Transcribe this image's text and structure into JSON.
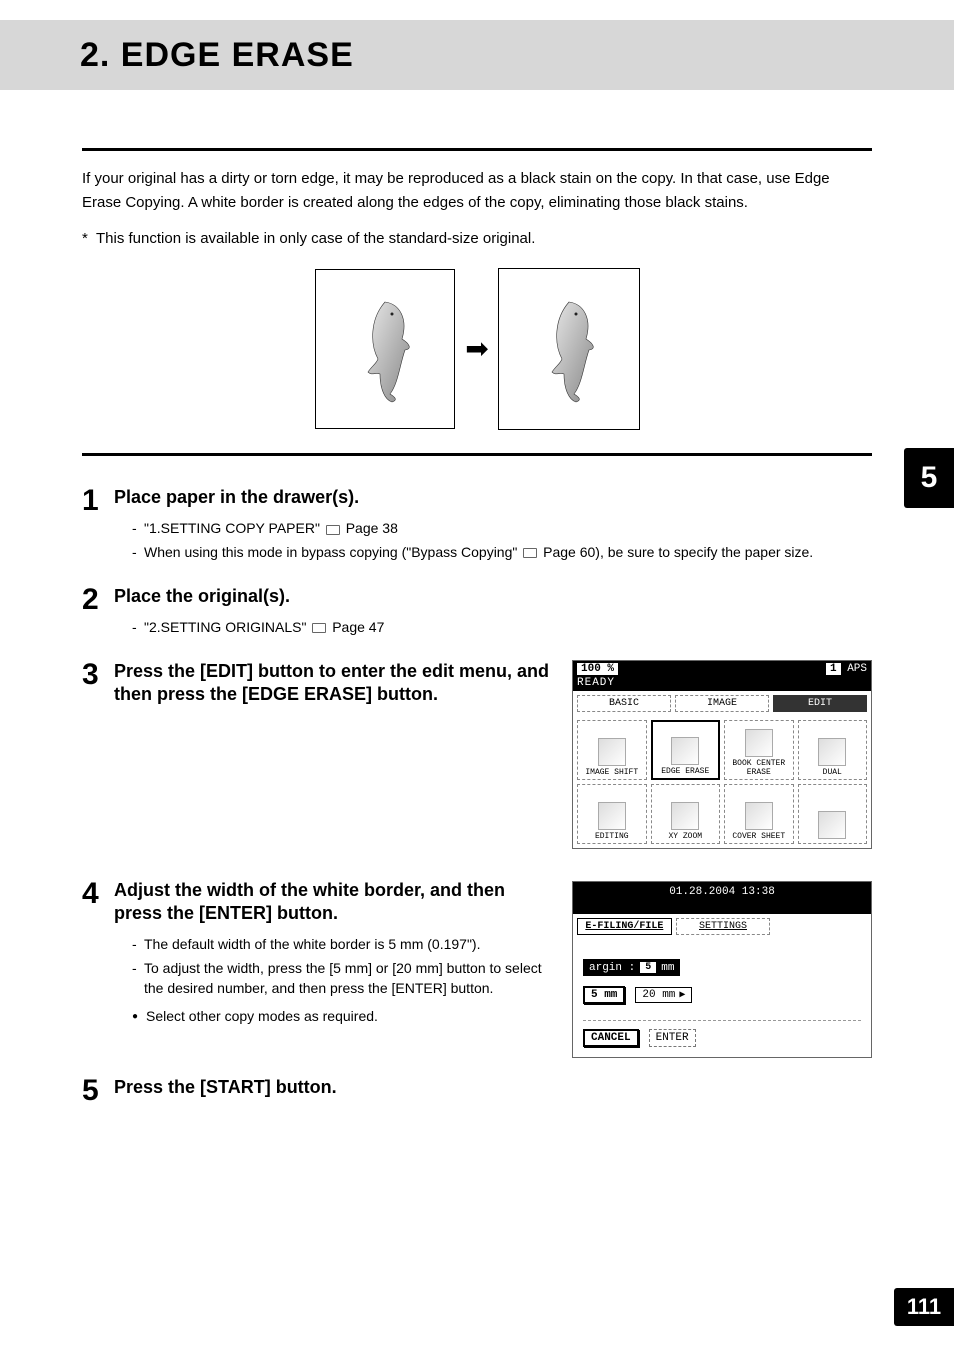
{
  "title": "2. EDGE ERASE",
  "chapter_tab": "5",
  "page_number": "111",
  "intro_para": "If your original has a dirty or torn edge, it may be reproduced as a black stain on the copy. In that case, use Edge Erase Copying. A white border is created along the edges of the copy, eliminating those black stains.",
  "note_line": "This function is available in only case of the standard-size original.",
  "steps": {
    "s1": {
      "num": "1",
      "title": "Place paper in the drawer(s).",
      "sub1_pre": "\"1.SETTING COPY PAPER\" ",
      "sub1_post": " Page 38",
      "sub2_pre": "When using this mode in bypass copying (\"Bypass Copying\" ",
      "sub2_post": " Page 60), be sure to specify the paper size."
    },
    "s2": {
      "num": "2",
      "title": "Place the original(s).",
      "sub1_pre": "\"2.SETTING ORIGINALS\" ",
      "sub1_post": " Page 47"
    },
    "s3": {
      "num": "3",
      "title": "Press the [EDIT] button to enter the edit menu, and then press the [EDGE ERASE] button."
    },
    "s4": {
      "num": "4",
      "title": "Adjust the width of the white border, and then press the [ENTER] button.",
      "sub1": "The default width of the white border is 5 mm (0.197\").",
      "sub2": "To adjust the width, press the [5 mm] or [20 mm] button to select the desired number, and then press the [ENTER] button.",
      "bullet": "Select other copy modes as required."
    },
    "s5": {
      "num": "5",
      "title": "Press the [START] button."
    }
  },
  "lcd1": {
    "zoom": "100 %",
    "count": "1",
    "mode": "APS",
    "ready": "READY",
    "tabs": {
      "basic": "BASIC",
      "image": "IMAGE",
      "edit": "EDIT"
    },
    "buttons": {
      "b1": "IMAGE SHIFT",
      "b2": "EDGE ERASE",
      "b3": "BOOK CENTER ERASE",
      "b4": "DUAL",
      "b5": "EDITING",
      "b6": "XY ZOOM",
      "b7": "COVER SHEET",
      "b8": ""
    }
  },
  "lcd2": {
    "datetime": "01.28.2004 13:38",
    "tabs": {
      "efiling": "E-FILING/FILE",
      "settings": "SETTINGS"
    },
    "label_pre": "argin :",
    "label_val": "5",
    "label_unit": "mm",
    "btn5": "5 mm",
    "btn20": "20 mm",
    "cancel": "CANCEL",
    "enter": "ENTER"
  }
}
